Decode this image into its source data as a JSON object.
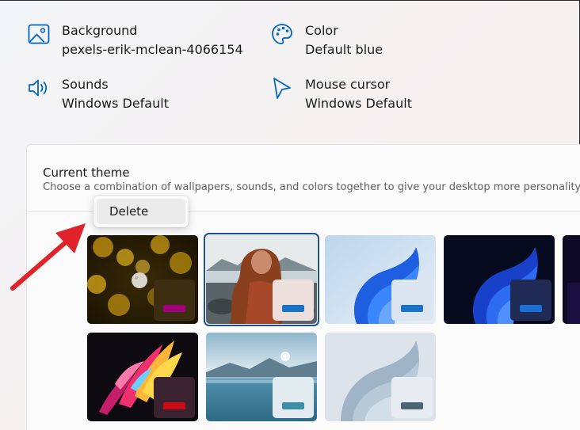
{
  "properties": {
    "background": {
      "label": "Background",
      "value": "pexels-erik-mclean-4066154",
      "icon": "image-icon"
    },
    "color": {
      "label": "Color",
      "value": "Default blue",
      "icon": "palette-icon"
    },
    "sounds": {
      "label": "Sounds",
      "value": "Windows Default",
      "icon": "speaker-icon"
    },
    "mouse_cursor": {
      "label": "Mouse cursor",
      "value": "Windows Default",
      "icon": "cursor-icon"
    }
  },
  "current_theme": {
    "title": "Current theme",
    "subtitle": "Choose a combination of wallpapers, sounds, and colors together to give your desktop more personality"
  },
  "context_menu": {
    "delete_label": "Delete"
  },
  "colors": {
    "accent_icon": "#0067c0",
    "selection_border": "#1c4f9a",
    "arrow": "#e0222a"
  },
  "themes": [
    {
      "name": "bokeh-moon-theme",
      "swatch": "#3d2e12",
      "accent": "#a0007c"
    },
    {
      "name": "custom-photo-theme",
      "swatch": "#ede0dc",
      "accent": "#1a73c8",
      "selected": true
    },
    {
      "name": "windows-light-theme",
      "swatch": "#dce6f0",
      "accent": "#1a73c8"
    },
    {
      "name": "windows-dark-theme",
      "swatch": "#1f2a55",
      "accent": "#1a6fd4"
    },
    {
      "name": "glow-theme",
      "swatch": "#3a2230",
      "accent": "#cc0a14"
    },
    {
      "name": "captured-motion-theme",
      "swatch": "#e2ecf0",
      "accent": "#3c8ea4"
    },
    {
      "name": "flow-theme",
      "swatch": "#e6ecf1",
      "accent": "#4c6572"
    }
  ]
}
